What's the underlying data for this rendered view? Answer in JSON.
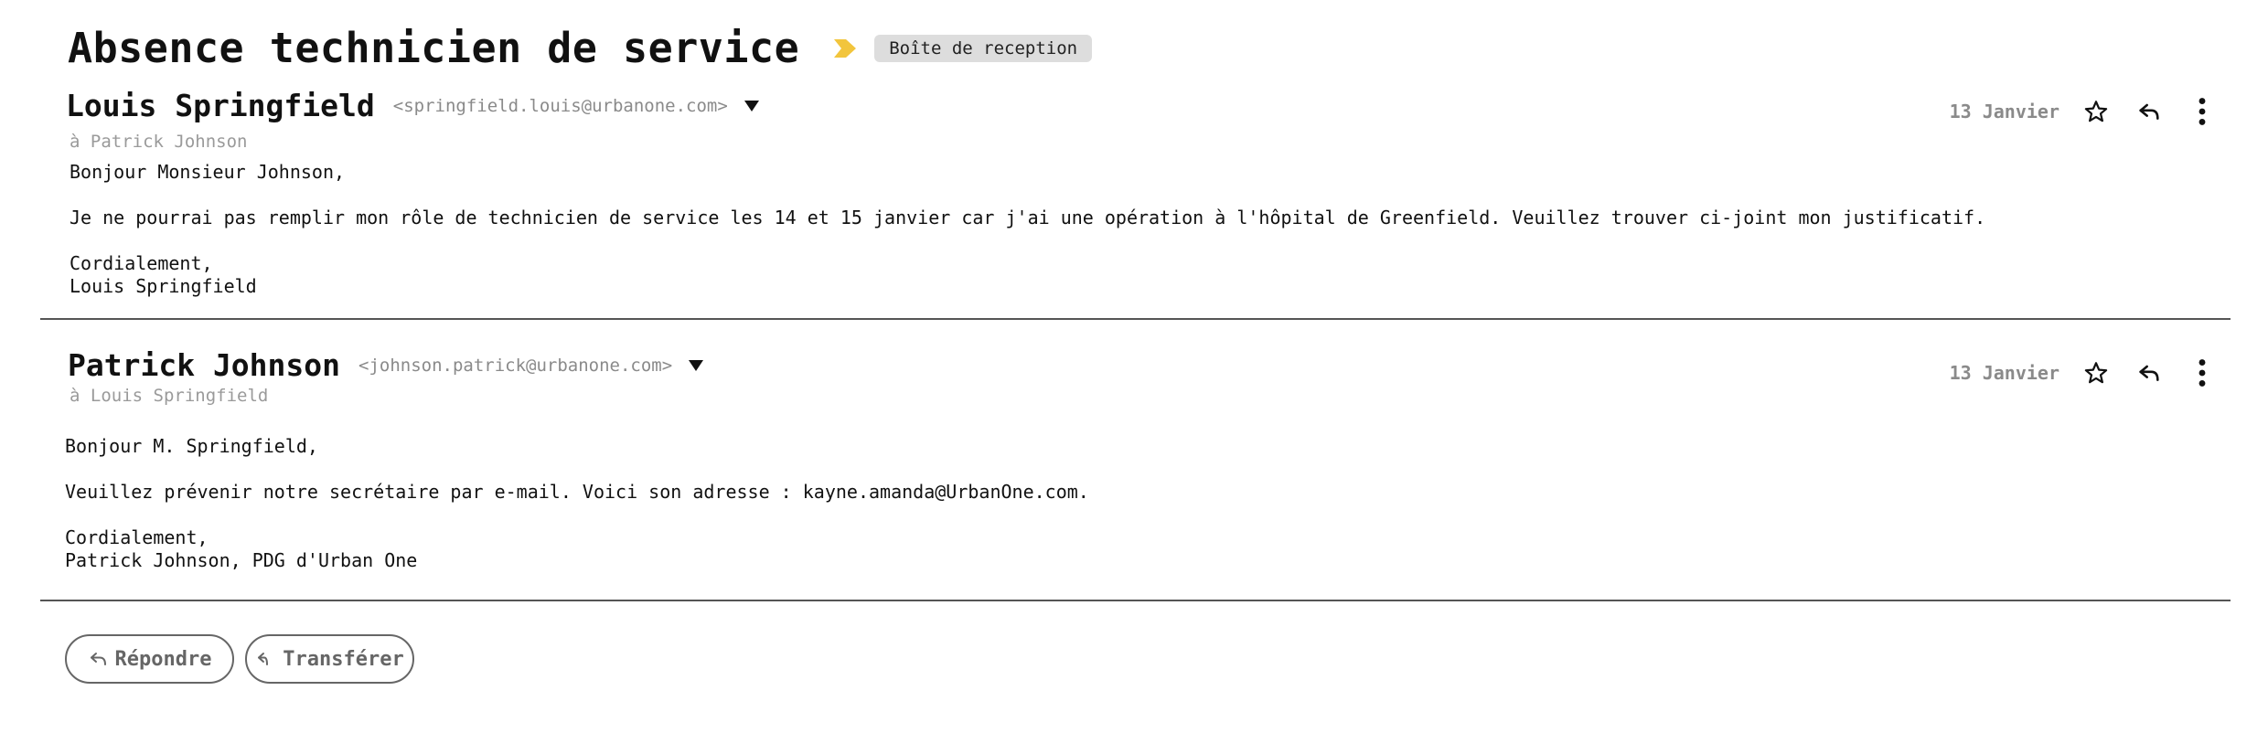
{
  "thread": {
    "title": "Absence technicien de service",
    "label": "Boîte de reception",
    "importance_color": "#f2c53d"
  },
  "messages": [
    {
      "sender_name": "Louis Springfield",
      "sender_email": "<springfield.louis@urbanone.com>",
      "recipient": "à Patrick Johnson",
      "date": "13 Janvier",
      "body": {
        "greeting": "Bonjour Monsieur Johnson,",
        "content": "Je ne pourrai pas remplir mon rôle de technicien de service les 14 et 15 janvier car j'ai une opération à l'hôpital de Greenfield. Veuillez trouver ci-joint mon justificatif.",
        "closing": "Cordialement,",
        "signature": "Louis Springfield"
      }
    },
    {
      "sender_name": "Patrick Johnson",
      "sender_email": "<johnson.patrick@urbanone.com>",
      "recipient": "à Louis Springfield",
      "date": "13 Janvier",
      "body": {
        "greeting": "Bonjour M. Springfield,",
        "content": "Veuillez prévenir notre secrétaire par e-mail. Voici son adresse : kayne.amanda@UrbanOne.com.",
        "closing": "Cordialement,",
        "signature": "Patrick Johnson, PDG d'Urban One"
      }
    }
  ],
  "footer": {
    "reply_label": "Répondre",
    "forward_label": "Transférer"
  },
  "icons": {
    "importance": "label-important-icon",
    "expand": "caret-down-icon",
    "star": "star-outline-icon",
    "reply": "reply-icon",
    "more": "more-vertical-icon",
    "forward": "forward-icon"
  }
}
